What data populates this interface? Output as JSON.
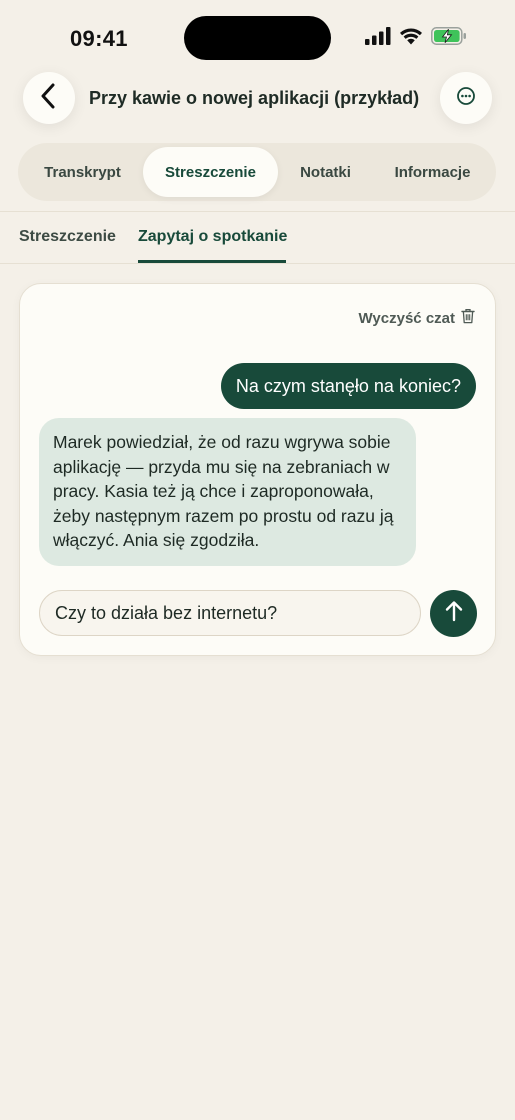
{
  "status_bar": {
    "time": "09:41",
    "icons": [
      "signal-icon",
      "wifi-icon",
      "battery-charging-icon"
    ]
  },
  "header": {
    "title": "Przy kawie o nowej aplikacji (przykład)",
    "back_icon": "chevron-left-icon",
    "more_icon": "ellipsis-circle-icon"
  },
  "tabs": [
    {
      "label": "Transkrypt",
      "active": false
    },
    {
      "label": "Streszczenie",
      "active": true
    },
    {
      "label": "Notatki",
      "active": false
    },
    {
      "label": "Informacje",
      "active": false
    }
  ],
  "subtabs": [
    {
      "label": "Streszczenie",
      "active": false
    },
    {
      "label": "Zapytaj o spotkanie",
      "active": true
    }
  ],
  "chat": {
    "clear_label": "Wyczyść czat",
    "clear_icon": "trash-icon",
    "messages": [
      {
        "role": "user",
        "text": "Na czym stanęło na koniec?"
      },
      {
        "role": "assistant",
        "text": "Marek powiedział, że od razu wgrywa sobie aplikację — przyda mu się na zebraniach w pracy. Kasia też ją chce i zaproponowała, żeby następnym razem po prostu od razu ją włączyć. Ania się zgodziła."
      }
    ],
    "input_value": "Czy to działa bez internetu?",
    "send_icon": "arrow-up-icon"
  },
  "colors": {
    "background": "#f4f0e8",
    "accent": "#184a3a",
    "assistant_bubble": "#dde9e1",
    "card": "#fdfcf7"
  }
}
